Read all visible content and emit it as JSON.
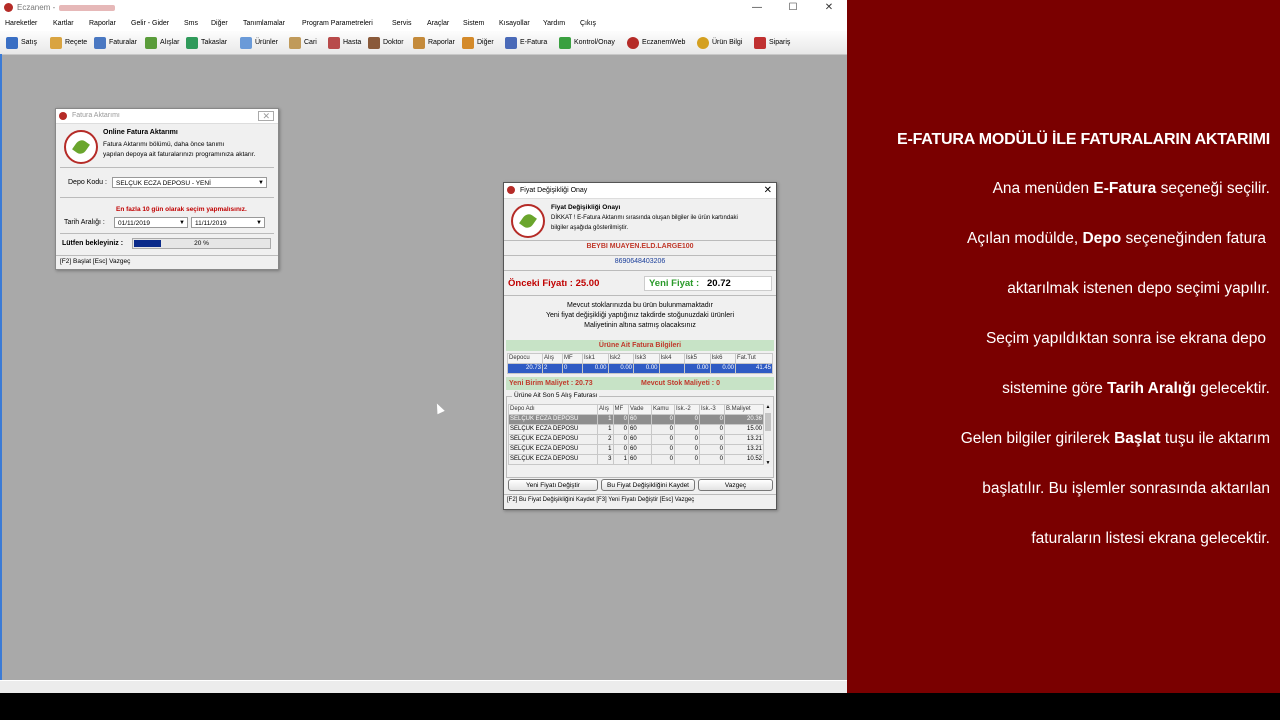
{
  "app": {
    "title": "Eczanem -",
    "window_controls": [
      "—",
      "☐",
      "✕"
    ],
    "menu": [
      "Hareketler",
      "Kartlar",
      "Raporlar",
      "Gelir - Gider",
      "Sms",
      "Diğer",
      "Tanımlamalar",
      "Program Parametreleri",
      "Servis",
      "Araçlar",
      "Sistem",
      "Kısayollar",
      "Yardım",
      "Çıkış"
    ],
    "toolbar": [
      {
        "label": "Satış",
        "icon": "cart-icon",
        "color": "#3a6fc4"
      },
      {
        "label": "Reçete",
        "icon": "prescription-icon",
        "color": "#d9a441"
      },
      {
        "label": "Faturalar",
        "icon": "truck-icon",
        "color": "#4a78c2"
      },
      {
        "label": "Alışlar",
        "icon": "checklist-icon",
        "color": "#5a9c3a"
      },
      {
        "label": "Takaslar",
        "icon": "exchange-icon",
        "color": "#2f9a5a"
      },
      {
        "label": "Ürünler",
        "icon": "bottle-icon",
        "color": "#6a9ad8"
      },
      {
        "label": "Cari",
        "icon": "contacts-icon",
        "color": "#c09a5a"
      },
      {
        "label": "Hasta",
        "icon": "patient-icon",
        "color": "#b84a4a"
      },
      {
        "label": "Doktor",
        "icon": "doctor-icon",
        "color": "#8a5a3a"
      },
      {
        "label": "Raporlar",
        "icon": "report-icon",
        "color": "#c48a3a"
      },
      {
        "label": "Diğer",
        "icon": "tools-icon",
        "color": "#d48a2a"
      },
      {
        "label": "E-Fatura",
        "icon": "e-invoice-icon",
        "color": "#4a6ab8"
      },
      {
        "label": "Kontrol/Onay",
        "icon": "its-check-icon",
        "color": "#3aa040"
      },
      {
        "label": "EczanemWeb",
        "icon": "eczanem-logo-icon",
        "color": "#b52b27"
      },
      {
        "label": "Ürün Bilgi",
        "icon": "info-icon",
        "color": "#d4a020"
      },
      {
        "label": "Sipariş",
        "icon": "basket-icon",
        "color": "#c03030"
      }
    ]
  },
  "fatura": {
    "title": "Fatura Aktarımı",
    "heading": "Online Fatura Aktarımı",
    "desc1": "Fatura Aktarımı bölümü, daha önce tanımı",
    "desc2": "yapılan depoya ait faturalarınızı programınıza aktarır.",
    "depo_label": "Depo Kodu :",
    "depo_value": "SELÇUK ECZA DEPOSU - YENİ",
    "warning": "En fazla 10 gün olarak seçim yapmalısınız.",
    "tarih_label": "Tarih Aralığı :",
    "date_from": "01/11/2019",
    "date_to": "11/11/2019",
    "wait_label": "Lütfen bekleyiniz :",
    "progress_text": "20 %",
    "progress": 0.2,
    "footer": "[F2] Başlat    [Esc] Vazgeç"
  },
  "fiyat": {
    "title": "Fiyat Değişikliği Onay",
    "heading": "Fiyat Değişikliği Onayı",
    "notice1": "DİKKAT ! E-Fatura Aktarımı sırasında oluşan bilgiler ile ürün kartındaki",
    "notice2": "bilgiler aşağıda gösterilmiştir.",
    "product_name": "BEYBI MUAYEN.ELD.LARGE100",
    "barcode": "8690648403206",
    "old_price_label": "Önceki Fiyatı : 25.00",
    "new_price_label": "Yeni Fiyat :",
    "new_price": "20.72",
    "msg1": "Mevcut stoklarınızda bu ürün bulunmamaktadır",
    "msg2": "Yeni fiyat değişikliği yaptığınız takdirde stoğunuzdaki ürünleri",
    "msg3": "Maliyetinin altına satmış olacaksınız",
    "invoice_band": "Ürüne Ait Fatura Bilgileri",
    "invoice_headers": [
      "Depocu",
      "Alış",
      "MF",
      "İsk1",
      "İsk2",
      "İsk3",
      "İsk4",
      "İsk5",
      "İsk6",
      "Fat.Tut"
    ],
    "invoice_row": [
      "20.73",
      "2",
      "0",
      "0.00",
      "0.00",
      "0.00",
      "",
      "0.00",
      "0.00",
      "41.45"
    ],
    "cost_label": "Yeni Birim Maliyet : 20.73",
    "stock_cost_label": "Mevcut Stok Maliyeti : 0",
    "history_legend": "Ürüne Ait Son 5 Alış Faturası",
    "history_headers": [
      "Depo Adı",
      "Alış",
      "MF",
      "Vade",
      "Kamu",
      "İsk.-2",
      "İsk.-3",
      "B.Maliyet"
    ],
    "history_rows": [
      [
        "SELÇUK ECZA DEPOSU",
        "1",
        "0",
        "60",
        "0",
        "0",
        "0",
        "20.36"
      ],
      [
        "SELÇUK ECZA DEPOSU",
        "1",
        "0",
        "60",
        "0",
        "0",
        "0",
        "15.00"
      ],
      [
        "SELÇUK ECZA DEPOSU",
        "2",
        "0",
        "60",
        "0",
        "0",
        "0",
        "13.21"
      ],
      [
        "SELÇUK ECZA DEPOSU",
        "1",
        "0",
        "60",
        "0",
        "0",
        "0",
        "13.21"
      ],
      [
        "SELÇUK ECZA DEPOSU",
        "3",
        "1",
        "60",
        "0",
        "0",
        "0",
        "10.52"
      ]
    ],
    "btn_new_price": "Yeni Fiyatı Değiştir",
    "btn_save": "Bu Fiyat Değişikliğini Kaydet",
    "btn_cancel": "Vazgeç",
    "footer": "[F2] Bu Fiyat Değişikliğini Kaydet    [F3] Yeni Fiyatı Değiştir    [Esc] Vazgeç",
    "close": "✕"
  },
  "panel": {
    "title": "E-FATURA MODÜLÜ İLE FATURALARIN AKTARIMI",
    "l1a": "Ana menüden ",
    "l1b": "E-Fatura",
    "l1c": " seçeneği seçilir.",
    "l2a": "Açılan modülde, ",
    "l2b": "Depo",
    "l2c": " seçeneğinden fatura",
    "l3": "aktarılmak istenen depo seçimi yapılır.",
    "l4": "Seçim yapıldıktan sonra ise ekrana depo",
    "l5a": "sistemine göre ",
    "l5b": "Tarih Aralığı",
    "l5c": " gelecektir.",
    "l6a": "Gelen bilgiler girilerek ",
    "l6b": "Başlat",
    "l6c": " tuşu ile aktarım",
    "l7": "başlatılır. Bu işlemler sonrasında aktarılan",
    "l8": "faturaların listesi ekrana gelecektir."
  }
}
